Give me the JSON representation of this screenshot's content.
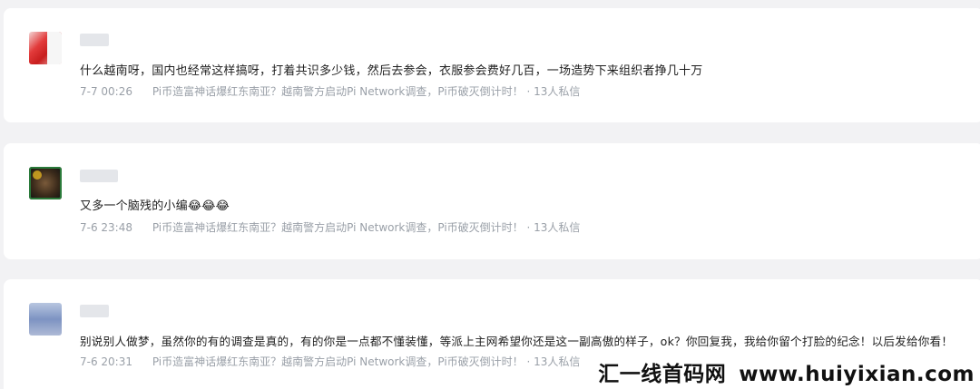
{
  "comments": [
    {
      "content": "什么越南呀，国内也经常这样搞呀，打着共识多少钱，然后去参会，衣服参会费好几百，一场造势下来组织者挣几十万",
      "emoji": "",
      "time": "7-7 00:26",
      "article": "Pi币造富神话爆红东南亚？越南警方启动Pi Network调查，Pi币破灭倒计时！",
      "dm": "· 13人私信"
    },
    {
      "content": "又多一个脑残的小编",
      "emoji": "😂😂😂",
      "time": "7-6 23:48",
      "article": "Pi币造富神话爆红东南亚？越南警方启动Pi Network调查，Pi币破灭倒计时！",
      "dm": "· 13人私信"
    },
    {
      "content": "别说别人做梦，虽然你的有的调查是真的，有的你是一点都不懂装懂，等派上主网希望你还是这一副高傲的样子，ok？你回复我，我给你留个打脸的纪念！以后发给你看！",
      "emoji": "",
      "time": "7-6 20:31",
      "article": "Pi币造富神话爆红东南亚？越南警方启动Pi Network调查，Pi币破灭倒计时！",
      "dm": "· 13人私信"
    }
  ],
  "watermark": {
    "brand": "汇一线首码网",
    "url": "www.huiyixian.com"
  }
}
